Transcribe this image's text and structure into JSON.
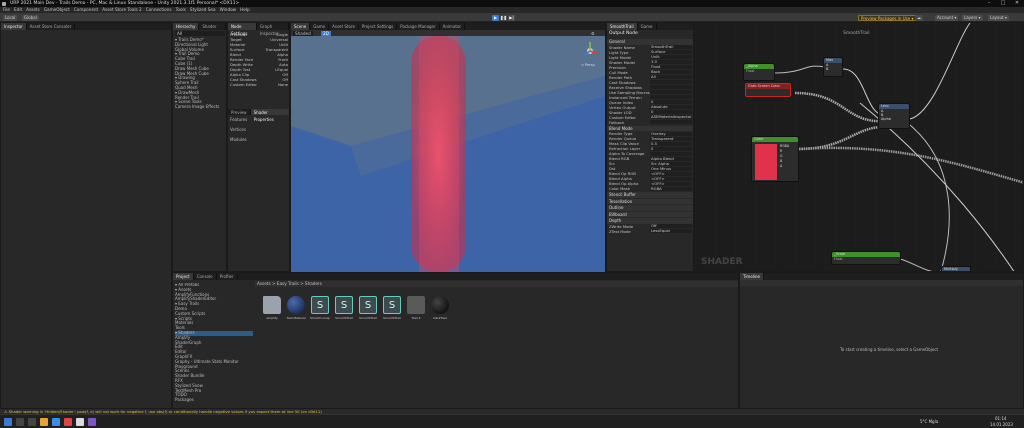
{
  "window": {
    "title": "URP 2021 Main Dev - Trails Demo - PC, Mac & Linux Standalone - Unity 2021.3.1f1 Personal* <DX11>",
    "controls": [
      "–",
      "□",
      "✕"
    ]
  },
  "menu": [
    "File",
    "Edit",
    "Assets",
    "GameObject",
    "Component",
    "Asset Store Tools 2",
    "Connections",
    "Tools",
    "Stylized Sea",
    "Window",
    "Help"
  ],
  "toolbar": {
    "left_buttons": [
      "Local",
      "Global"
    ],
    "preview_packages": "Preview Packages in Use ▾",
    "account": "Account ▾",
    "layers": "Layers ▾",
    "layout": "Layout ▾"
  },
  "left_panel": {
    "tabs": [
      "Inspector",
      "Asset Store Consoler"
    ]
  },
  "hierarchy": {
    "tabs": [
      "Hierarchy",
      "Shader Graph"
    ],
    "search": "All",
    "items": [
      "▾ Trails Demo*",
      "  Directional Light",
      "  Global Volume",
      "  ▾ Trail Demo",
      "    Cube Trail",
      "    Cube (1)",
      "    Draw Mesh Cube",
      "    Draw Mesh Cube",
      "  ▾ Drawing",
      "    Sphere Trail",
      "    Quad Mesh",
      "  ▾ DrawMesh",
      "    Render Trail",
      "    ▾ Scene Tools",
      "  Camera Image Effects"
    ]
  },
  "graph_inspector": {
    "tabs": [
      "Node Settings",
      "Graph Inspector"
    ],
    "rows": [
      [
        "Precision",
        "Single"
      ],
      [
        "Target",
        "Universal"
      ],
      [
        "Material",
        "Unlit"
      ],
      [
        "Surface",
        "Transparent"
      ],
      [
        "Blend",
        "Alpha"
      ],
      [
        "Render Face",
        "Front"
      ],
      [
        "Depth Write",
        "Auto"
      ],
      [
        "Depth Test",
        "LEqual"
      ],
      [
        "Alpha Clip",
        "Off"
      ],
      [
        "Cast Shadows",
        "Off"
      ],
      [
        "Custom Editor",
        "None"
      ]
    ],
    "sub_tabs": [
      "Preview",
      "Shader Properties"
    ],
    "sections": [
      "Features",
      "Vertices",
      "Modules"
    ]
  },
  "scene_view": {
    "tabs": [
      "Scene",
      "Game",
      "Asset Store",
      "Project Settings",
      "Package Manager",
      "Animator"
    ],
    "shading_mode": "Shaded",
    "mode_2d": "2D",
    "persp_label": "< Persp"
  },
  "output_node": {
    "tabs": [
      "SmoothTrail",
      "Game"
    ],
    "title": "Output Node",
    "sections": [
      {
        "name": "General",
        "rows": [
          [
            "Shader Name",
            "SmoothTrail"
          ],
          [
            "Light Type",
            "Surface"
          ],
          [
            "Light Model",
            "Unlit"
          ],
          [
            "Shader Model",
            "3.0"
          ],
          [
            "Precision",
            "Float"
          ],
          [
            "Cull Mode",
            "Back"
          ],
          [
            "Render Path",
            "All"
          ],
          [
            "Cast Shadows",
            ""
          ],
          [
            "Receive Shadows",
            ""
          ],
          [
            "Use Sampling Macros",
            ""
          ],
          [
            "Instanced Terrain",
            ""
          ],
          [
            "Queue Index",
            "0"
          ],
          [
            "Vertex Output",
            "Absolute"
          ],
          [
            "Shader LOD",
            "0"
          ],
          [
            "Custom Editor",
            "ASEMaterialInspector"
          ],
          [
            "Fallback",
            ""
          ]
        ]
      },
      {
        "name": "Blend Mode",
        "rows": [
          [
            "Render Type",
            "Overlay"
          ],
          [
            "Render Queue",
            "Transparent"
          ],
          [
            "Mask Clip Value",
            "0.5"
          ],
          [
            "Refraction Layer",
            "0"
          ],
          [
            "Alpha To Coverage",
            ""
          ],
          [
            "Blend RGB",
            "Alpha Blend"
          ],
          [
            "Src",
            "Src Alpha"
          ],
          [
            "Dst",
            "One Minus"
          ],
          [
            "Blend Op RGB",
            "<OFF>"
          ],
          [
            "Blend Alpha",
            "<OFF>"
          ],
          [
            "Blend Op Alpha",
            "<OFF>"
          ],
          [
            "Color Mask",
            "RGBA"
          ]
        ]
      },
      {
        "name": "Stencil Buffer",
        "rows": []
      },
      {
        "name": "Tessellation",
        "rows": []
      },
      {
        "name": "Outline",
        "rows": []
      },
      {
        "name": "Billboard",
        "rows": []
      },
      {
        "name": "Depth",
        "rows": [
          [
            "ZWrite Mode",
            "Off"
          ],
          [
            "ZTest Mode",
            "LessEqual"
          ]
        ]
      }
    ]
  },
  "node_graph": {
    "name": "SmoothTrail",
    "watermark": "SHADER",
    "nodes": [
      {
        "title": "_Alpha",
        "sub": "Float",
        "color": "#3f8f2b"
      },
      {
        "title": "Max",
        "sub": "",
        "color": "#3b4f6b"
      },
      {
        "title": "Grab Screen Color",
        "sub": "",
        "color": "#8a1f1f"
      },
      {
        "title": "Lerp",
        "sub": "",
        "color": "#3b4f6b"
      },
      {
        "title": "Color",
        "sub": "",
        "color": "#3f8f2b"
      },
      {
        "title": "_Scale",
        "sub": "Float",
        "color": "#3f8f2b"
      },
      {
        "title": "Multiply",
        "sub": "",
        "color": "#3b4f6b"
      }
    ],
    "ports": {
      "max_inputs": [
        "A",
        "B"
      ],
      "lerp_inputs": [
        "A",
        "B",
        "Alpha"
      ],
      "color_outputs": [
        "RGBA",
        "R",
        "G",
        "B",
        "A"
      ]
    }
  },
  "project": {
    "tabs": [
      "Project",
      "Console",
      "Profiler"
    ],
    "folders": [
      "▾ All Prefabs",
      "▾ Assets",
      "  AmplifyFunctions",
      "  AmplifyShaderEditor",
      "  ▾ Easy Trails",
      "    Demo",
      "    Custom Scripts",
      "    ▾ Scripts",
      "      Materials",
      "      Tools",
      "    ▾ Shaders",
      "      Amplify",
      "      ShaderGraph",
      "  Edit",
      "  Editor",
      "  GraphFX",
      "  Graphy - Ultimate Stats Monitor",
      "  Playground",
      "  Scenes",
      "  Shader Bundle",
      "  RFX",
      "  Stylized Snow",
      "  TextMesh Pro",
      "  TODO",
      "  Packages"
    ],
    "breadcrumb": "Assets > Easy Trails > Shaders",
    "assets": [
      {
        "name": "Amplify",
        "kind": "folder"
      },
      {
        "name": "Trail Material",
        "kind": "sphere"
      },
      {
        "name": "Smooth Graph",
        "kind": "shader"
      },
      {
        "name": "SmoothTrail",
        "kind": "shader"
      },
      {
        "name": "SmoothTrail",
        "kind": "shader"
      },
      {
        "name": "SmoothTrail",
        "kind": "shader"
      },
      {
        "name": "Trail 2",
        "kind": "grey"
      },
      {
        "name": "DarkTrail",
        "kind": "sphere-dark"
      }
    ]
  },
  "timeline": {
    "tabs": [
      "Timeline"
    ],
    "message": "To start creating a timeline, select a GameObject"
  },
  "status": "Shader warning in 'Hidden/Shader': pow(f, e) will not work for negative f, use abs(f) or conditionally handle negative values if you expect them at line 50 (on d3d11)",
  "taskbar": {
    "weather": "5°C Mgla",
    "time": "01:14",
    "date": "14.01.2023"
  },
  "colors": {
    "accent": "#3c7ad6",
    "trail_red": "#e0324a",
    "status_yellow": "#e8c24a",
    "scene_blue": "#3a60a0"
  }
}
